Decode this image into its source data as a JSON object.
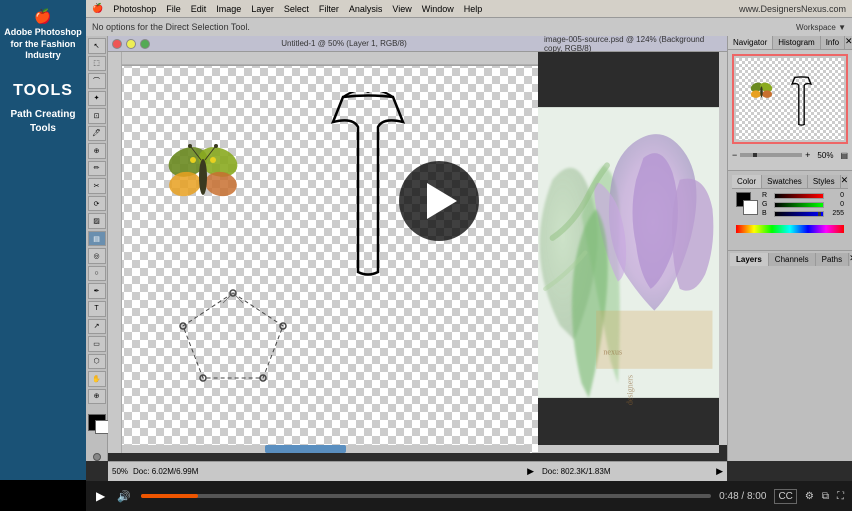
{
  "sidebar": {
    "title": "Adobe Photoshop for the Fashion Industry",
    "tools_label": "TOOLS",
    "path_creating_label": "Path Creating Tools"
  },
  "menu_bar": {
    "apple": "🍎",
    "items": [
      "Photoshop",
      "File",
      "Edit",
      "Image",
      "Layer",
      "Select",
      "Filter",
      "Analysis",
      "View",
      "Window",
      "Help"
    ]
  },
  "info_bar": {
    "text": "No options for the Direct Selection Tool."
  },
  "window1": {
    "title": "Untitled-1 @ 50% (Layer 1, RGB/8)",
    "zoom": "50%",
    "doc_size": "Doc: 6.02M/6.99M"
  },
  "window2": {
    "title": "image-005-source.psd @ 124% (Background copy, RGB/8)",
    "doc_size": "Doc: 802.3K/1.83M"
  },
  "navigator": {
    "tab": "Navigator",
    "histogram_tab": "Histogram",
    "info_tab": "Info",
    "zoom_value": "50%"
  },
  "color_panel": {
    "tab": "Color",
    "swatches_tab": "Swatches",
    "styles_tab": "Styles",
    "r_label": "R",
    "g_label": "G",
    "b_label": "B",
    "r_value": "0",
    "g_value": "0",
    "b_value": "255"
  },
  "layers_panel": {
    "layers_tab": "Layers",
    "channels_tab": "Channels",
    "paths_tab": "Paths"
  },
  "controls": {
    "play_label": "▶",
    "time_current": "0:48",
    "time_total": "8:00",
    "time_display": "0:48 / 8:00"
  },
  "website": "www.DesignersNexus.com"
}
